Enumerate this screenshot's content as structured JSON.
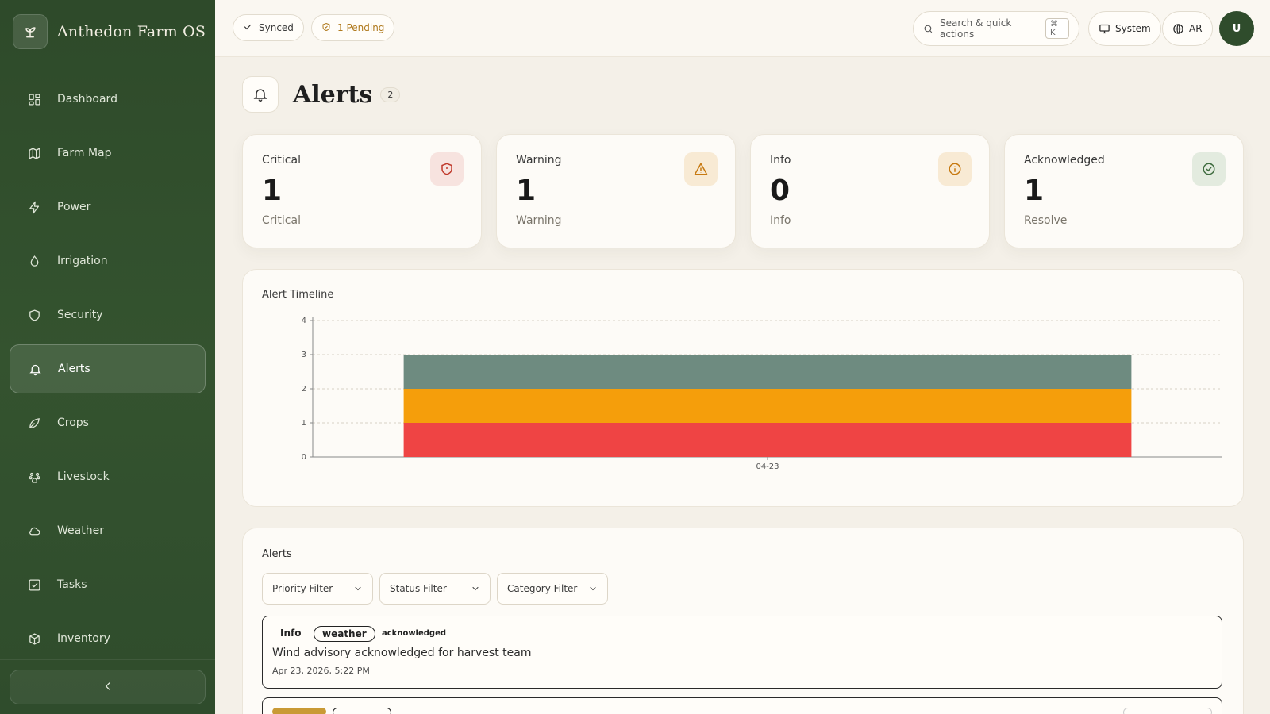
{
  "app": {
    "name": "Anthedon Farm OS"
  },
  "sidebar": {
    "items": [
      {
        "label": "Dashboard",
        "icon": "dashboard-icon"
      },
      {
        "label": "Farm Map",
        "icon": "map-icon"
      },
      {
        "label": "Power",
        "icon": "bolt-icon"
      },
      {
        "label": "Irrigation",
        "icon": "droplet-icon"
      },
      {
        "label": "Security",
        "icon": "shield-icon"
      },
      {
        "label": "Alerts",
        "icon": "bell-icon",
        "active": true
      },
      {
        "label": "Crops",
        "icon": "leaf-icon"
      },
      {
        "label": "Livestock",
        "icon": "livestock-icon"
      },
      {
        "label": "Weather",
        "icon": "cloud-icon"
      },
      {
        "label": "Tasks",
        "icon": "checkbox-icon"
      },
      {
        "label": "Inventory",
        "icon": "box-icon"
      }
    ]
  },
  "topbar": {
    "synced": "Synced",
    "pending": "1 Pending",
    "search_label": "Search & quick actions",
    "search_kbd": "⌘ K",
    "theme": "System",
    "language": "AR",
    "avatar_initial": "U"
  },
  "page": {
    "title": "Alerts",
    "count": "2"
  },
  "stats": [
    {
      "label": "Critical",
      "value": "1",
      "sub": "Critical",
      "icon": "shield-alert-icon",
      "color": "#c0392b",
      "bg": "#f7e3df"
    },
    {
      "label": "Warning",
      "value": "1",
      "sub": "Warning",
      "icon": "warning-triangle-icon",
      "color": "#c77a12",
      "bg": "#f8ead4"
    },
    {
      "label": "Info",
      "value": "0",
      "sub": "Info",
      "icon": "info-circle-icon",
      "color": "#c77a12",
      "bg": "#f8ead4"
    },
    {
      "label": "Acknowledged",
      "value": "1",
      "sub": "Resolve",
      "icon": "check-circle-icon",
      "color": "#3e6b3e",
      "bg": "#e3ebdf"
    }
  ],
  "chart_data": {
    "type": "bar",
    "title": "Alert Timeline",
    "categories": [
      "04-23"
    ],
    "stacked": true,
    "series": [
      {
        "values": [
          1
        ],
        "color": "#ef4444"
      },
      {
        "values": [
          1
        ],
        "color": "#f59e0b"
      },
      {
        "values": [
          1
        ],
        "color": "#6e8b80"
      }
    ],
    "ylim": [
      0,
      4
    ],
    "yticks": [
      0,
      1,
      2,
      3,
      4
    ],
    "grid": true
  },
  "alerts_list": {
    "title": "Alerts",
    "filters": [
      "Priority Filter",
      "Status Filter",
      "Category Filter"
    ],
    "items": [
      {
        "priority": "Info",
        "category": "weather",
        "status": "acknowledged",
        "message": "Wind advisory acknowledged for harvest team",
        "time": "Apr 23, 2026, 5:22 PM"
      }
    ]
  }
}
